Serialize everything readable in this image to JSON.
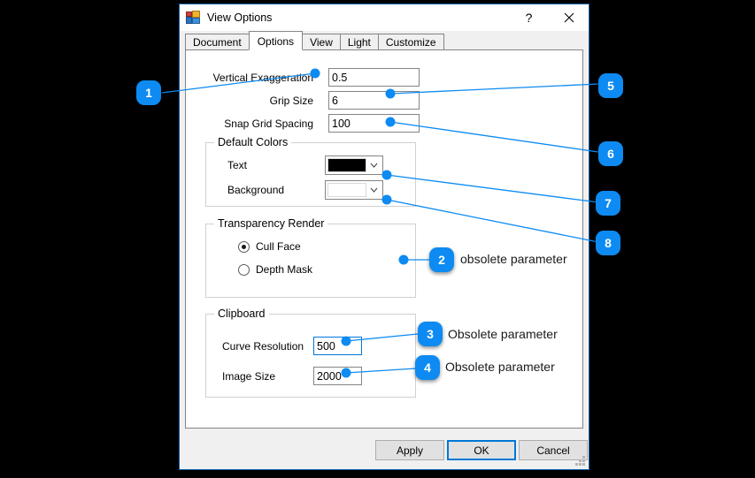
{
  "window": {
    "title": "View Options",
    "icon": "windows-form-icon",
    "help_label": "?",
    "close_label": "close-icon"
  },
  "tabs": [
    {
      "label": "Document",
      "active": false
    },
    {
      "label": "Options",
      "active": true
    },
    {
      "label": "View",
      "active": false
    },
    {
      "label": "Light",
      "active": false
    },
    {
      "label": "Customize",
      "active": false
    }
  ],
  "options_tab": {
    "fields": [
      {
        "label": "Vertical Exaggeration",
        "value": "0.5",
        "focused": false
      },
      {
        "label": "Grip Size",
        "value": "6",
        "focused": false
      },
      {
        "label": "Snap Grid Spacing",
        "value": "100",
        "focused": false
      }
    ],
    "default_colors": {
      "title": "Default Colors",
      "rows": [
        {
          "label": "Text",
          "swatch": "#000000"
        },
        {
          "label": "Background",
          "swatch": "#ffffff"
        }
      ]
    },
    "transparency_render": {
      "title": "Transparency Render",
      "options": [
        {
          "label": "Cull Face",
          "checked": true
        },
        {
          "label": "Depth Mask",
          "checked": false
        }
      ]
    },
    "clipboard": {
      "title": "Clipboard",
      "fields": [
        {
          "label": "Curve Resolution",
          "value": "500",
          "focused": true
        },
        {
          "label": "Image Size",
          "value": "2000",
          "focused": false
        }
      ]
    }
  },
  "footer": {
    "buttons": [
      {
        "label": "Apply",
        "default": false
      },
      {
        "label": "OK",
        "default": true
      },
      {
        "label": "Cancel",
        "default": false
      }
    ]
  },
  "annotations": {
    "accent_color": "#0d8bf2",
    "items": [
      {
        "number": "1",
        "text": ""
      },
      {
        "number": "2",
        "text": "obsolete parameter"
      },
      {
        "number": "3",
        "text": "Obsolete parameter"
      },
      {
        "number": "4",
        "text": "Obsolete parameter"
      },
      {
        "number": "5",
        "text": ""
      },
      {
        "number": "6",
        "text": ""
      },
      {
        "number": "7",
        "text": ""
      },
      {
        "number": "8",
        "text": ""
      }
    ]
  }
}
